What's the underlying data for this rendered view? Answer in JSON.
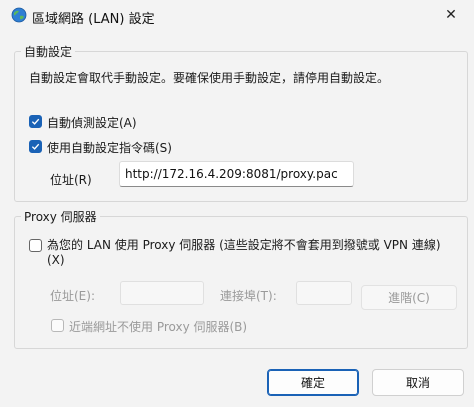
{
  "window": {
    "title": "區域網路 (LAN) 設定",
    "close_glyph": "✕"
  },
  "auto_config": {
    "group_title": "自動設定",
    "description": "自動設定會取代手動設定。要確保使用手動設定，請停用自動設定。",
    "auto_detect": {
      "label": "自動偵測設定(A)",
      "checked": true
    },
    "use_script": {
      "label": "使用自動設定指令碼(S)",
      "checked": true
    },
    "address_label": "位址(R)",
    "address_value": "http://172.16.4.209:8081/proxy.pac"
  },
  "proxy": {
    "group_title": "Proxy 伺服器",
    "use_proxy": {
      "label_line1": "為您的 LAN 使用 Proxy 伺服器 (這些設定將不會套用到撥號或 VPN 連線)",
      "label_line2": "(X)",
      "checked": false
    },
    "address_label": "位址(E):",
    "address_value": "",
    "port_label": "連接埠(T):",
    "port_value": "",
    "advanced_label": "進階(C)",
    "bypass_local": {
      "label": "近端網址不使用 Proxy 伺服器(B)",
      "checked": false,
      "disabled": true
    }
  },
  "buttons": {
    "ok_label": "確定",
    "cancel_label": "取消"
  },
  "colors": {
    "accent": "#1a62b6",
    "window_bg": "#f3f3f3",
    "disabled_text": "#9a9a9a"
  },
  "icons": {
    "app": "globe-network-icon",
    "close": "close-icon",
    "check": "checkmark-icon"
  }
}
